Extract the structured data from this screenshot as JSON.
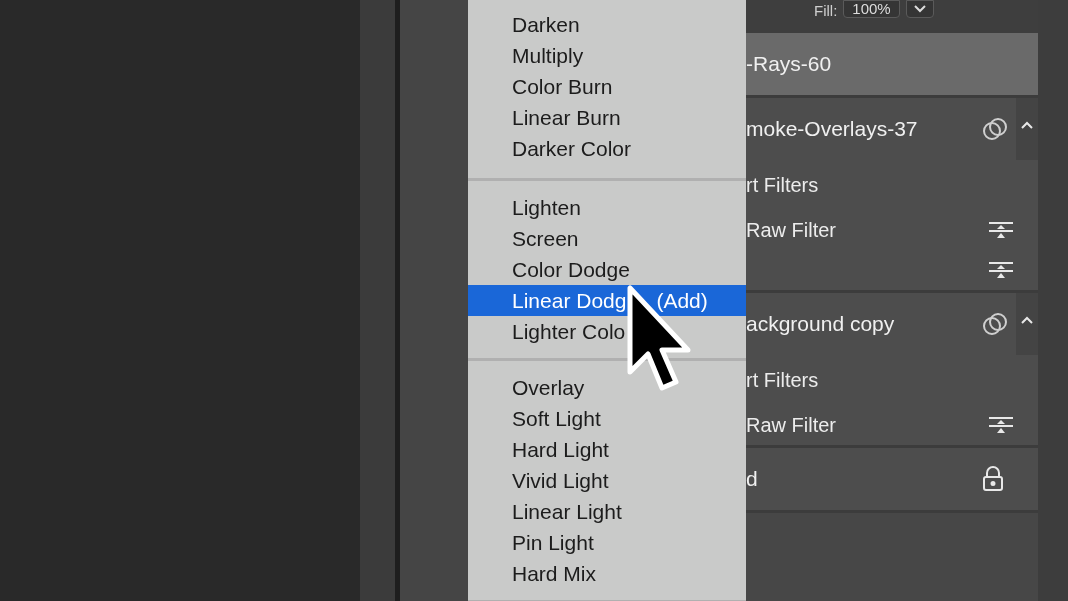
{
  "fill": {
    "label": "Fill:",
    "value": "100%"
  },
  "blend_menu": {
    "groups": [
      {
        "items": [
          {
            "label": "Darken",
            "selected": false
          },
          {
            "label": "Multiply",
            "selected": false
          },
          {
            "label": "Color Burn",
            "selected": false
          },
          {
            "label": "Linear Burn",
            "selected": false
          },
          {
            "label": "Darker Color",
            "selected": false
          }
        ]
      },
      {
        "items": [
          {
            "label": "Lighten",
            "selected": false
          },
          {
            "label": "Screen",
            "selected": false
          },
          {
            "label": "Color Dodge",
            "selected": false
          },
          {
            "label": "Linear Dodg",
            "label_after_cursor": "(Add)",
            "selected": true
          },
          {
            "label": "Lighter Colo",
            "selected": false
          }
        ]
      },
      {
        "items": [
          {
            "label": "Overlay",
            "selected": false
          },
          {
            "label": "Soft Light",
            "selected": false
          },
          {
            "label": "Hard Light",
            "selected": false
          },
          {
            "label": "Vivid Light",
            "selected": false
          },
          {
            "label": "Linear Light",
            "selected": false
          },
          {
            "label": "Pin Light",
            "selected": false
          },
          {
            "label": "Hard Mix",
            "selected": false
          }
        ]
      }
    ]
  },
  "layers": [
    {
      "name": "-Rays-60",
      "selected": true
    },
    {
      "name": "moke-Overlays-37",
      "selected": false,
      "smart_object": true,
      "expanded": true,
      "entries": [
        {
          "kind": "header",
          "label": "rt Filters"
        },
        {
          "kind": "filter",
          "label": "Raw Filter"
        },
        {
          "kind": "option"
        }
      ]
    },
    {
      "name": "ackground copy",
      "selected": false,
      "smart_object": true,
      "expanded": true,
      "entries": [
        {
          "kind": "header",
          "label": "rt Filters"
        },
        {
          "kind": "filter",
          "label": "Raw Filter"
        }
      ]
    },
    {
      "name": "d",
      "selected": false,
      "locked": true
    }
  ]
}
